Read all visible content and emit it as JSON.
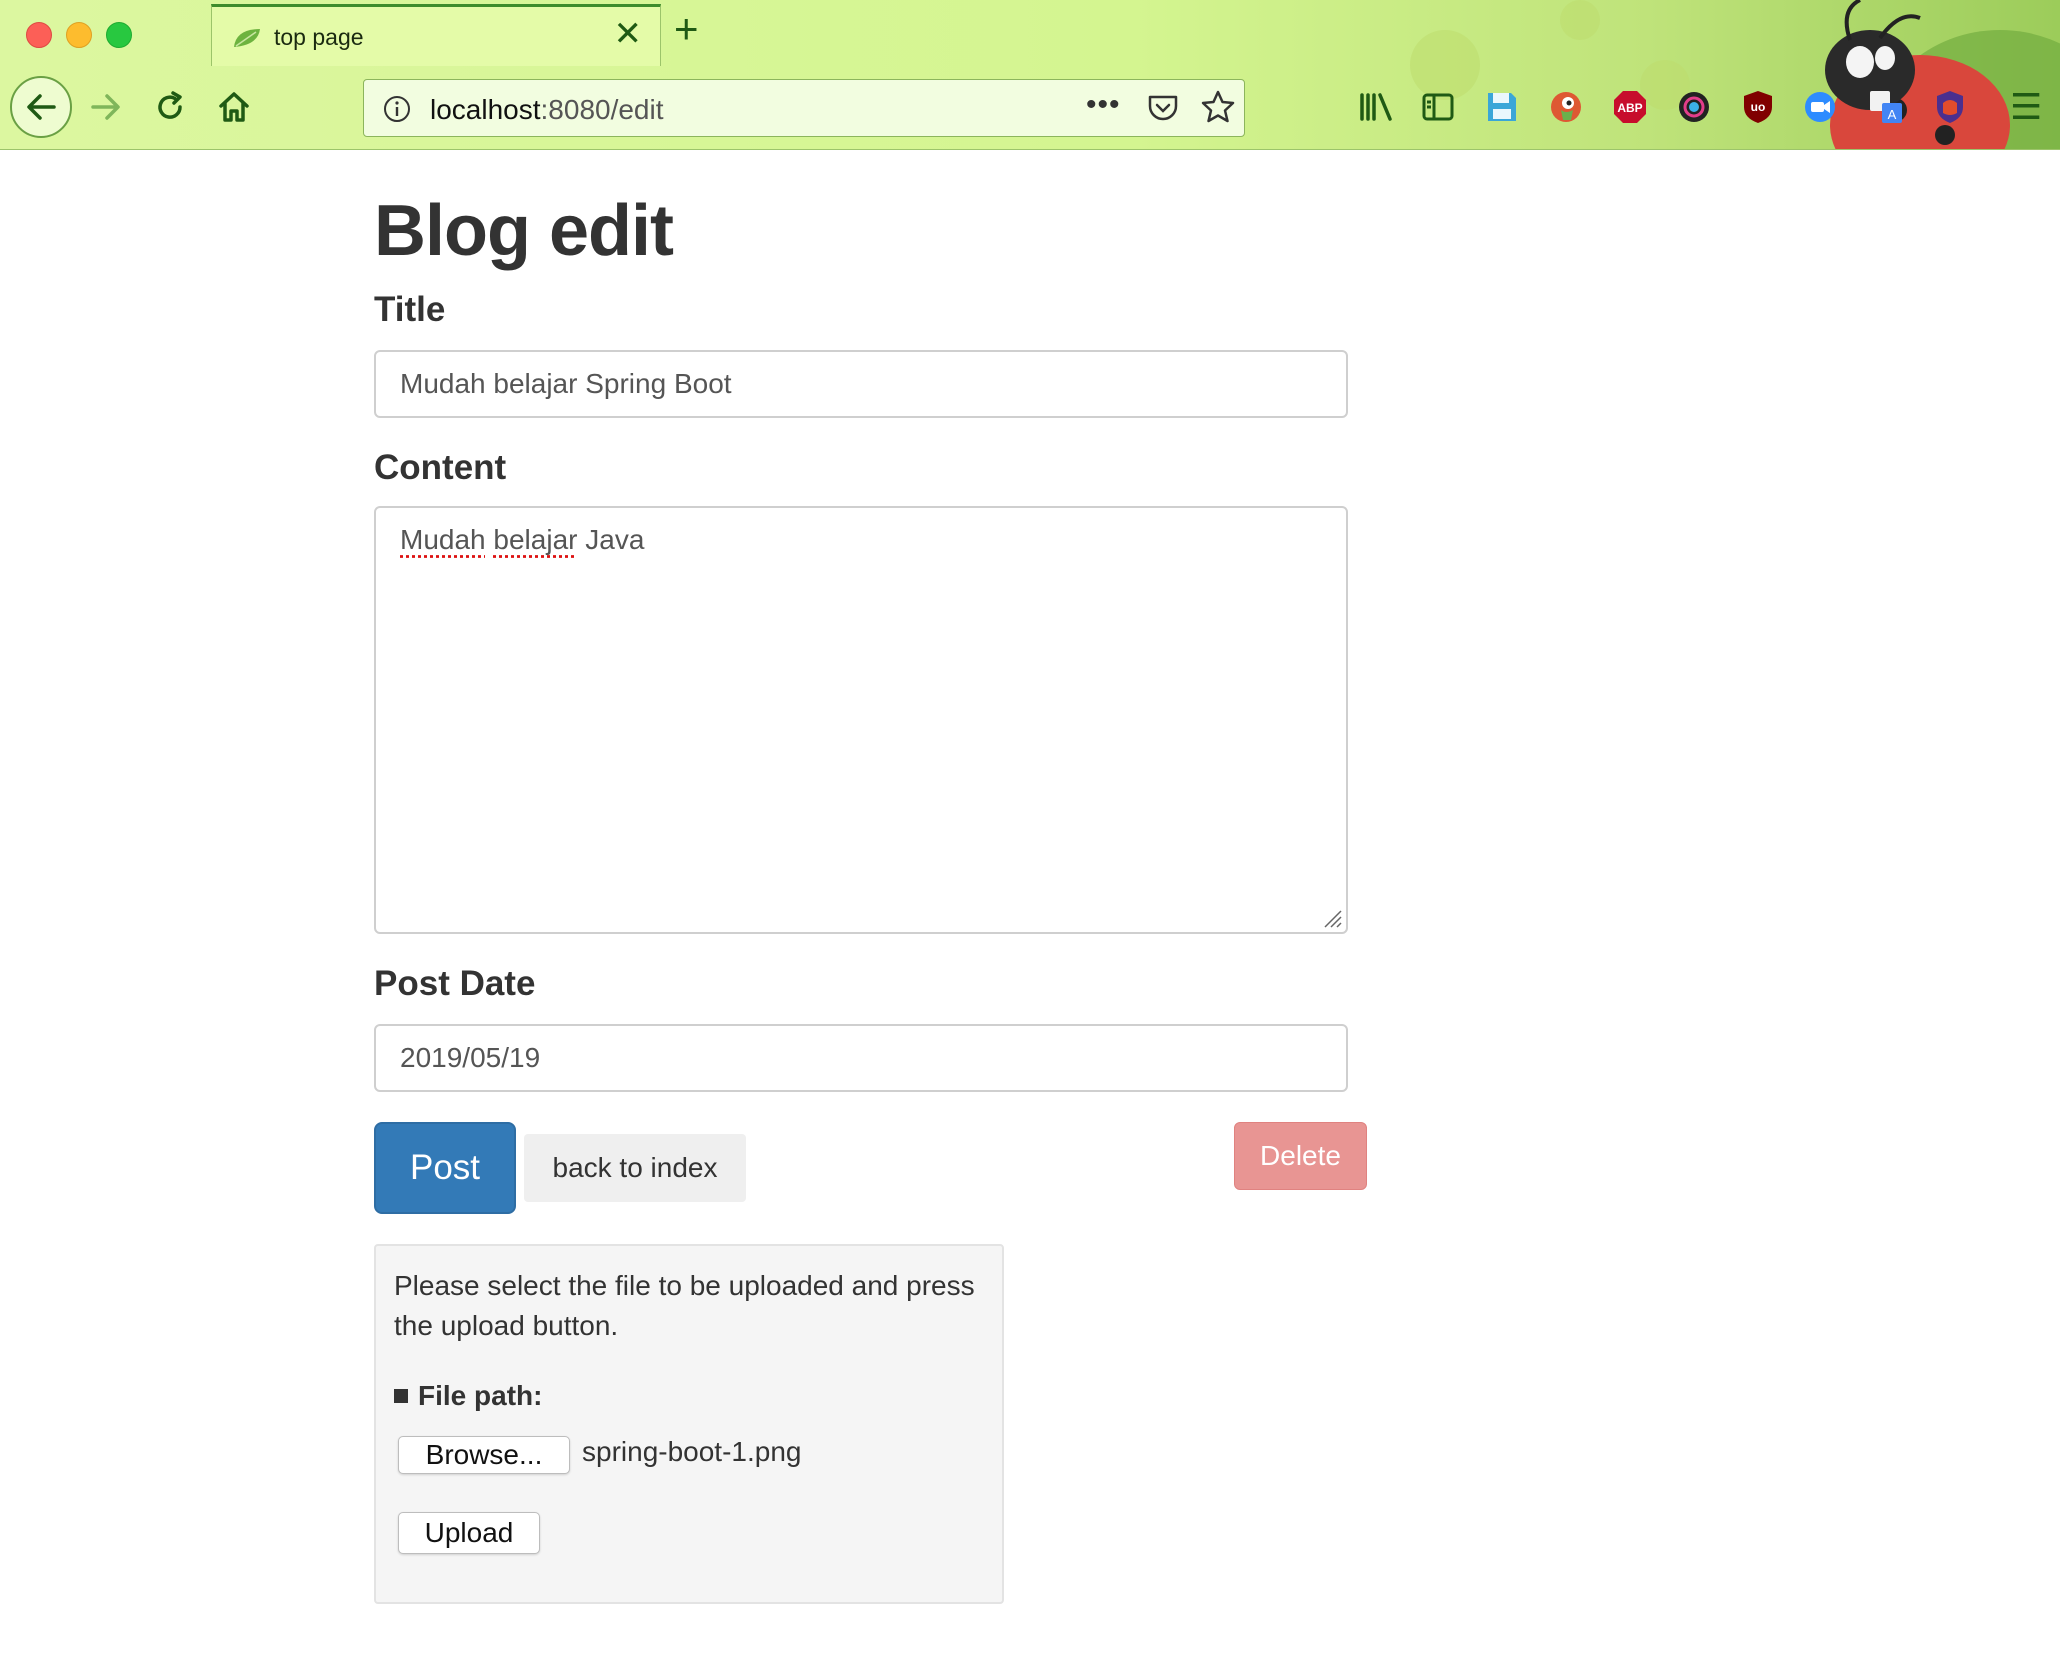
{
  "browser": {
    "tab_title": "top page",
    "tab_close": "✕",
    "new_tab": "+",
    "url_host": "localhost",
    "url_path": ":8080/edit",
    "url_more": "•••",
    "extensions": [
      "library-icon",
      "sidebar-icon",
      "save-icon",
      "duckduckgo-icon",
      "adblock-plus-icon",
      "color-picker-icon",
      "ublock-origin-icon",
      "zoom-icon",
      "translate-icon",
      "privacy-badger-icon"
    ],
    "adblock_label": "ABP",
    "ublock_label": "uo",
    "menu_icon": "☰"
  },
  "page": {
    "heading": "Blog edit",
    "title_label": "Title",
    "title_value": "Mudah belajar Spring Boot",
    "content_label": "Content",
    "content_value_words": [
      "Mudah",
      "belajar",
      "Java"
    ],
    "post_date_label": "Post Date",
    "post_date_value": "2019/05/19",
    "post_button": "Post",
    "back_button": "back to index",
    "delete_button": "Delete"
  },
  "upload": {
    "help_text": "Please select the file to be uploaded and press the upload button.",
    "file_path_label": "File path:",
    "browse_button": "Browse...",
    "file_name": "spring-boot-1.png",
    "upload_button": "Upload"
  },
  "colors": {
    "primary": "#337ab7",
    "danger": "#e89593",
    "chrome_green": "#dcf7a0"
  }
}
